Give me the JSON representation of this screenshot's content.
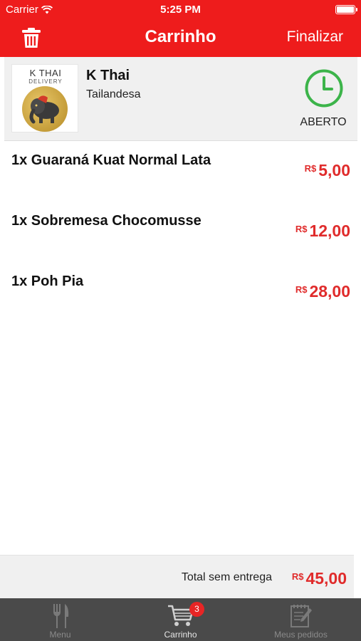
{
  "status_bar": {
    "carrier": "Carrier",
    "time": "5:25 PM"
  },
  "header": {
    "title": "Carrinho",
    "finalize_label": "Finalizar",
    "icons": {
      "delete": "trash-icon"
    }
  },
  "restaurant": {
    "logo_line1": "K THAI",
    "logo_line2": "DELIVERY",
    "name": "K Thai",
    "category": "Tailandesa",
    "status": "ABERTO",
    "status_icon": "clock-icon"
  },
  "cart_items": [
    {
      "name": "1x Guaraná Kuat Normal Lata",
      "currency": "R$",
      "price": "5,00"
    },
    {
      "name": "1x Sobremesa Chocomusse",
      "currency": "R$",
      "price": "12,00"
    },
    {
      "name": "1x Poh Pia",
      "currency": "R$",
      "price": "28,00"
    }
  ],
  "total": {
    "label": "Total sem entrega",
    "currency": "R$",
    "value": "45,00"
  },
  "tabbar": {
    "tabs": [
      {
        "label": "Menu",
        "icon": "fork-knife-icon"
      },
      {
        "label": "Carrinho",
        "icon": "cart-icon"
      },
      {
        "label": "Meus pedidos",
        "icon": "notepad-icon"
      }
    ],
    "cart_badge": "3",
    "active_tab": "Carrinho"
  },
  "colors": {
    "brand_red": "#ee1c1c",
    "price_red": "#e02b2b",
    "open_green": "#3cb44a",
    "tabbar_bg": "#4a4a4a"
  }
}
